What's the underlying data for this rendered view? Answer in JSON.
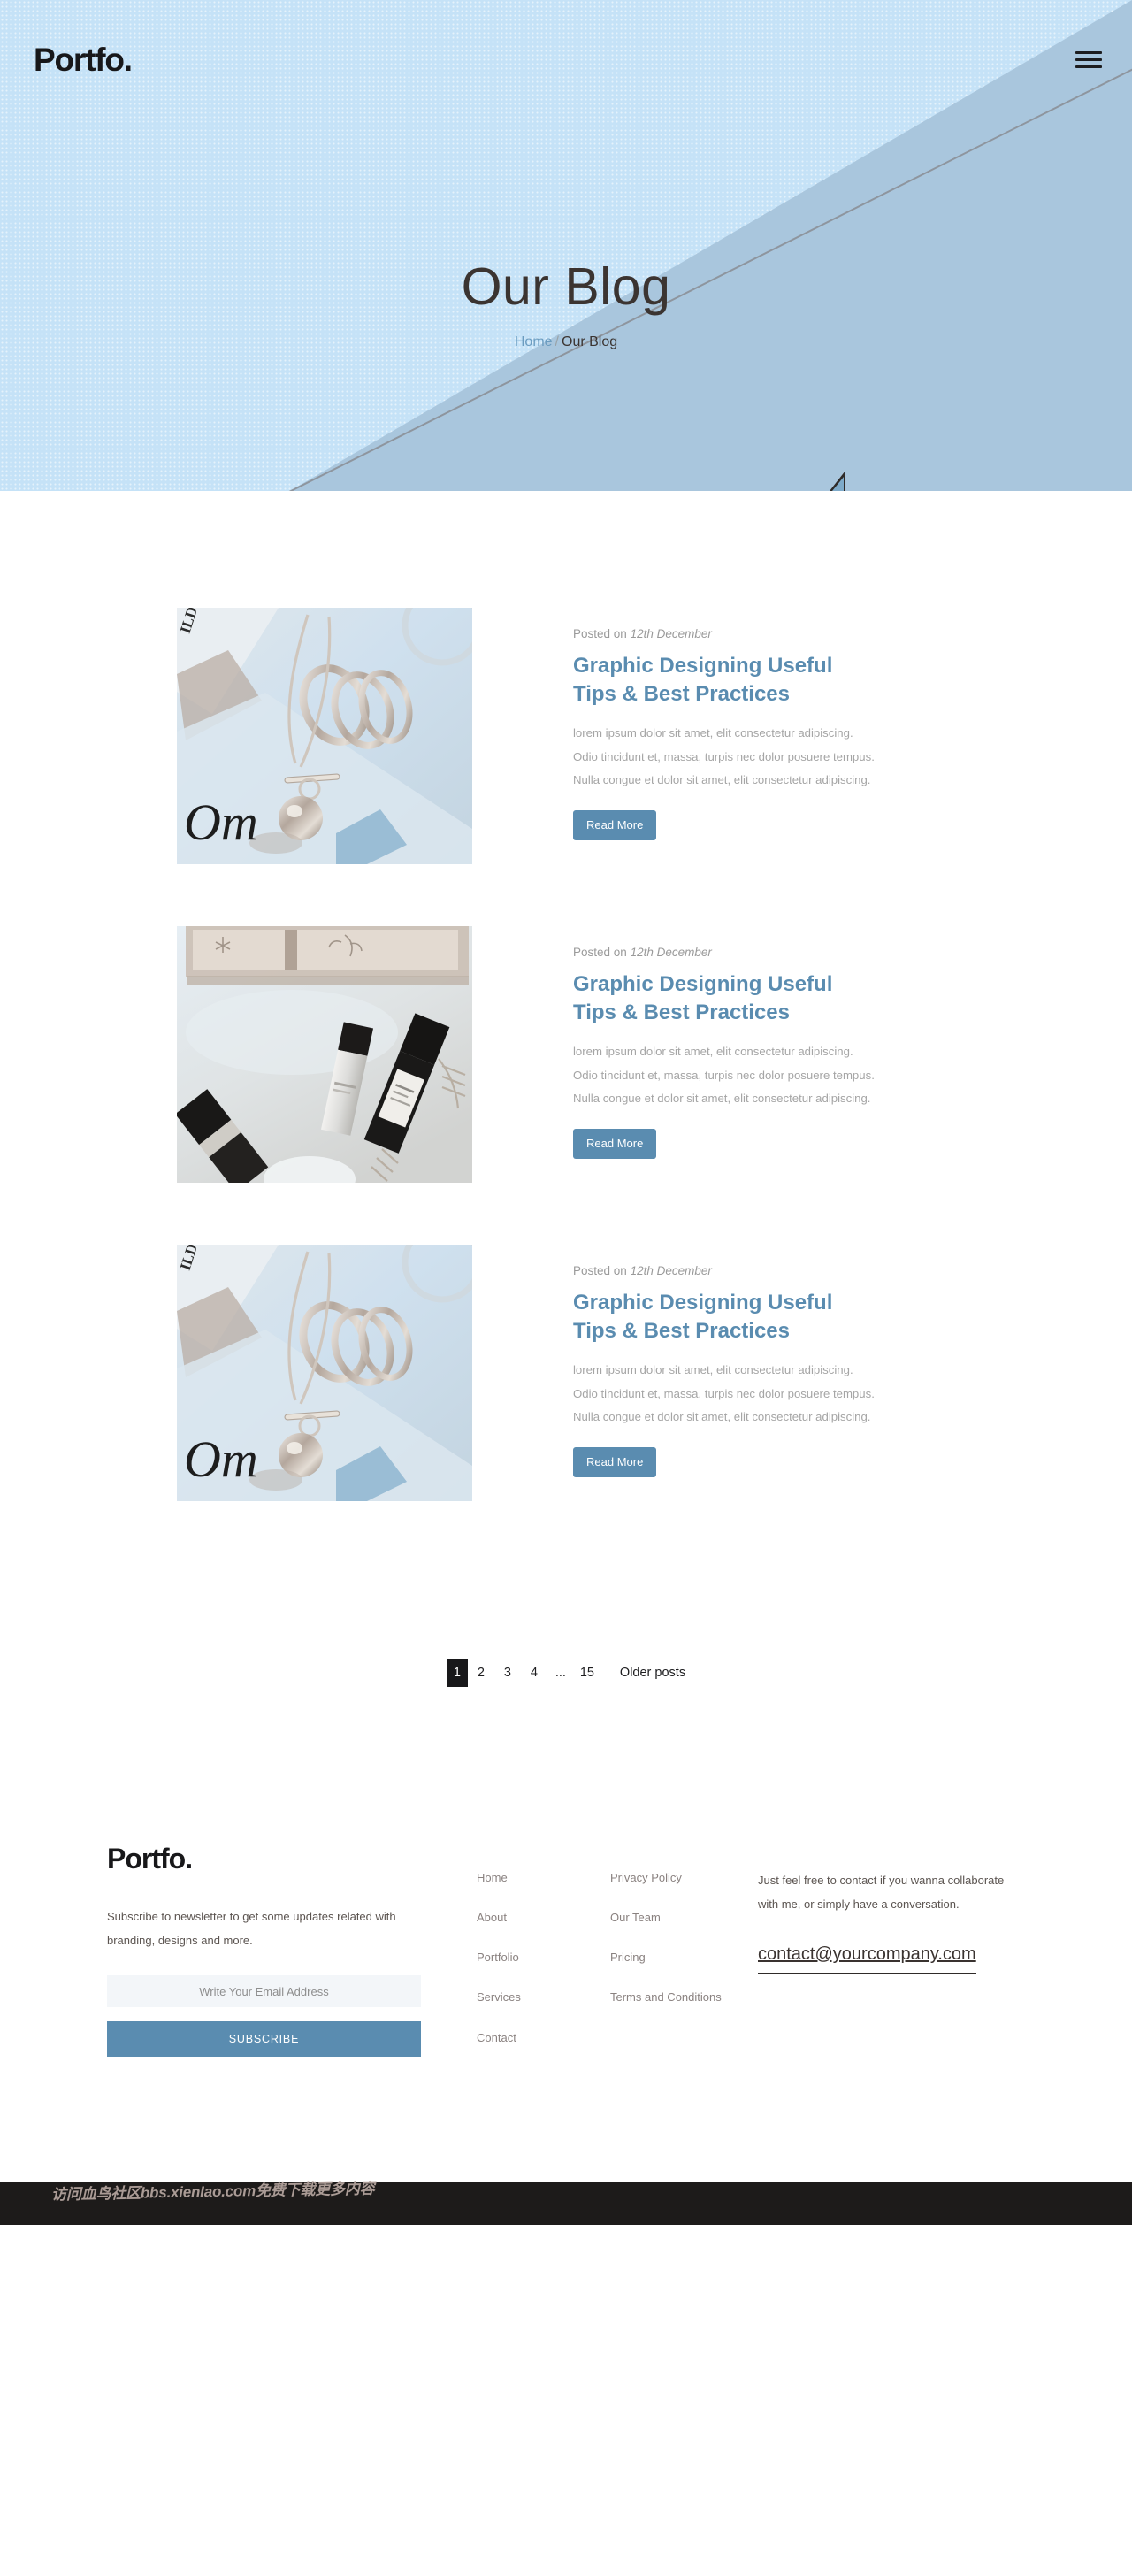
{
  "header": {
    "brand": "Portfo.",
    "menu_icon": "hamburger-icon",
    "title": "Our Blog",
    "breadcrumb": {
      "home": "Home",
      "separator": "/",
      "current": "Our Blog"
    }
  },
  "blog": {
    "posts": [
      {
        "meta_prefix": "Posted on",
        "date": "12th December",
        "title": "Graphic Designing Useful Tips & Best Practices",
        "excerpt": "lorem ipsum dolor sit amet, elit consectetur adipiscing. Odio tincidunt et, massa, turpis nec dolor posuere tempus. Nulla congue et dolor sit amet, elit consectetur adipiscing.",
        "button": "Read More",
        "image": "jewelry-necklace-rings-photo"
      },
      {
        "meta_prefix": "Posted on",
        "date": "12th December",
        "title": "Graphic Designing Useful Tips & Best Practices",
        "excerpt": "lorem ipsum dolor sit amet, elit consectetur adipiscing. Odio tincidunt et, massa, turpis nec dolor posuere tempus. Nulla congue et dolor sit amet, elit consectetur adipiscing.",
        "button": "Read More",
        "image": "cosmetics-bottles-photo"
      },
      {
        "meta_prefix": "Posted on",
        "date": "12th December",
        "title": "Graphic Designing Useful Tips & Best Practices",
        "excerpt": "lorem ipsum dolor sit amet, elit consectetur adipiscing. Odio tincidunt et, massa, turpis nec dolor posuere tempus. Nulla congue et dolor sit amet, elit consectetur adipiscing.",
        "button": "Read More",
        "image": "jewelry-necklace-rings-photo"
      }
    ]
  },
  "pagination": {
    "pages": [
      "1",
      "2",
      "3",
      "4",
      "...",
      "15"
    ],
    "active": "1",
    "older_label": "Older posts"
  },
  "footer": {
    "logo": "Portfo.",
    "description": "Subscribe to newsletter to get some updates related with branding, designs and more.",
    "email_placeholder": "Write Your Email Address",
    "email_value": "",
    "subscribe_label": "SUBSCRIBE",
    "links_col1": [
      "Home",
      "About",
      "Portfolio",
      "Services",
      "Contact"
    ],
    "links_col2": [
      "Privacy Policy",
      "Our Team",
      "Pricing",
      "Terms and Conditions"
    ],
    "contact_text": "Just feel free to contact if you wanna collaborate with me, or simply have a conversation.",
    "contact_email": "contact@yourcompany.com"
  },
  "watermark": {
    "text": "访问血鸟社区bbs.xienIao.com免费下载更多内容"
  },
  "colors": {
    "hero_light": "#c5e2f7",
    "hero_dark": "#a9c6dd",
    "accent": "#5a8cb0",
    "title_link": "#5a8cb0",
    "muted_text": "#a5a5a5",
    "dark": "#18181a"
  }
}
